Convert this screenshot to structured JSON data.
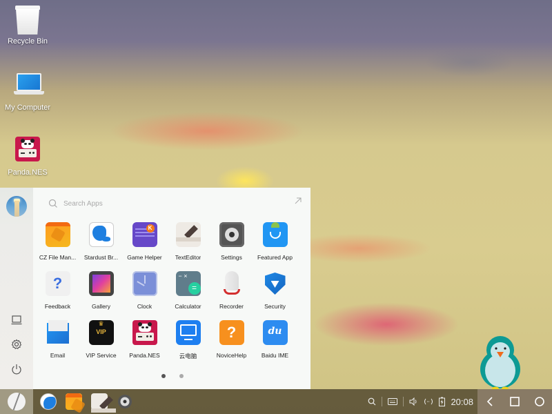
{
  "desktop": {
    "icons": [
      {
        "label": "Recycle Bin",
        "icon": "recycle-bin-icon"
      },
      {
        "label": "My Computer",
        "icon": "laptop-icon"
      },
      {
        "label": "Panda.NES",
        "icon": "panda-nes-icon"
      }
    ]
  },
  "start_menu": {
    "search": {
      "placeholder": "Search Apps",
      "value": ""
    },
    "expand_icon": "expand-arrow-icon",
    "side": {
      "avatar_icon": "lighthouse-avatar",
      "buttons": [
        {
          "name": "desktop",
          "icon": "laptop-outline-icon"
        },
        {
          "name": "settings",
          "icon": "gear-icon"
        },
        {
          "name": "power",
          "icon": "power-icon"
        }
      ]
    },
    "apps": [
      {
        "label": "CZ File Man...",
        "icon": "cz-file-manager-icon"
      },
      {
        "label": "Stardust Br...",
        "icon": "stardust-browser-icon"
      },
      {
        "label": "Game Helper",
        "icon": "game-helper-icon"
      },
      {
        "label": "TextEditor",
        "icon": "text-editor-icon"
      },
      {
        "label": "Settings",
        "icon": "settings-icon"
      },
      {
        "label": "Featured App",
        "icon": "featured-app-icon"
      },
      {
        "label": "Feedback",
        "icon": "feedback-icon"
      },
      {
        "label": "Gallery",
        "icon": "gallery-icon"
      },
      {
        "label": "Clock",
        "icon": "clock-icon"
      },
      {
        "label": "Calculator",
        "icon": "calculator-icon"
      },
      {
        "label": "Recorder",
        "icon": "recorder-icon"
      },
      {
        "label": "Security",
        "icon": "security-icon"
      },
      {
        "label": "Email",
        "icon": "email-icon"
      },
      {
        "label": "VIP Service",
        "icon": "vip-service-icon"
      },
      {
        "label": "Panda.NES",
        "icon": "panda-nes-icon"
      },
      {
        "label": "云电脑",
        "icon": "cloud-pc-icon"
      },
      {
        "label": "NoviceHelp",
        "icon": "novice-help-icon"
      },
      {
        "label": "Baidu IME",
        "icon": "baidu-ime-icon"
      }
    ],
    "pager": {
      "pages": 2,
      "current": 1
    }
  },
  "taskbar": {
    "start_icon": "start-logo-icon",
    "pinned": [
      {
        "name": "stardust-browser",
        "icon": "stardust-browser-icon"
      },
      {
        "name": "cz-file-manager",
        "icon": "cz-file-manager-icon"
      },
      {
        "name": "text-editor",
        "icon": "text-editor-icon"
      },
      {
        "name": "settings",
        "icon": "settings-icon"
      }
    ],
    "tray": {
      "icons": [
        "search-icon",
        "keyboard-icon",
        "volume-icon",
        "network-icon",
        "battery-charging-icon"
      ],
      "time": "20:08"
    },
    "nav": [
      "back-icon",
      "recents-icon",
      "home-icon"
    ]
  },
  "colors": {
    "menu_bg": "#f7f9f7",
    "taskbar_bg": "#5c5237",
    "accent_blue": "#1e7ff0"
  }
}
